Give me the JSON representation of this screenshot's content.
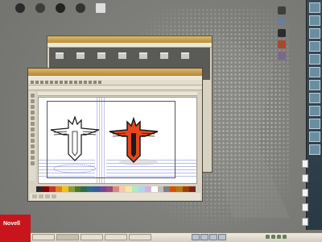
{
  "desktop": {
    "launchers": [
      {
        "label": "",
        "icon": "computer-icon",
        "color": "#2b2b2b"
      },
      {
        "label": "",
        "icon": "firefox-icon",
        "color": "#3d3d3a"
      },
      {
        "label": "",
        "icon": "trash-icon",
        "color": "#222222"
      },
      {
        "label": "",
        "icon": "camera-icon",
        "color": "#333333"
      },
      {
        "label": "",
        "icon": "monitor-icon",
        "color": "#dddddd"
      }
    ],
    "right_icons": [
      {
        "label": "",
        "icon": "drive-icon",
        "color": "#3e3e3e"
      },
      {
        "label": "",
        "icon": "network-icon",
        "color": "#6a7e9a"
      },
      {
        "label": "",
        "icon": "terminal-icon",
        "color": "#2c2c2c"
      },
      {
        "label": "",
        "icon": "app-icon",
        "color": "#a84a2a"
      },
      {
        "label": "",
        "icon": "settings-icon",
        "color": "#7a6a8a"
      }
    ]
  },
  "back_window": {
    "title": ""
  },
  "front_window": {
    "title": "",
    "menu": [
      "",
      "",
      "",
      "",
      "",
      "",
      "",
      "",
      ""
    ],
    "palette": [
      "#2a2a2a",
      "#8b0000",
      "#c0392b",
      "#e67e22",
      "#f1c40f",
      "#8e9a3a",
      "#4a7a2a",
      "#2f6b4a",
      "#2a6b8a",
      "#3a5a9a",
      "#6a4a9a",
      "#9a4a7a",
      "#d98880",
      "#f5cba7",
      "#f9e79f",
      "#abebc6",
      "#aed6f1",
      "#d2b4de",
      "#ffffff",
      "#bdbdbd",
      "#7f7f7f",
      "#d35400",
      "#b9770e",
      "#a04000",
      "#7b241c"
    ]
  },
  "panel": {
    "brand": "Novell",
    "tasks": [
      "",
      "",
      "",
      "",
      ""
    ],
    "clock": ""
  }
}
